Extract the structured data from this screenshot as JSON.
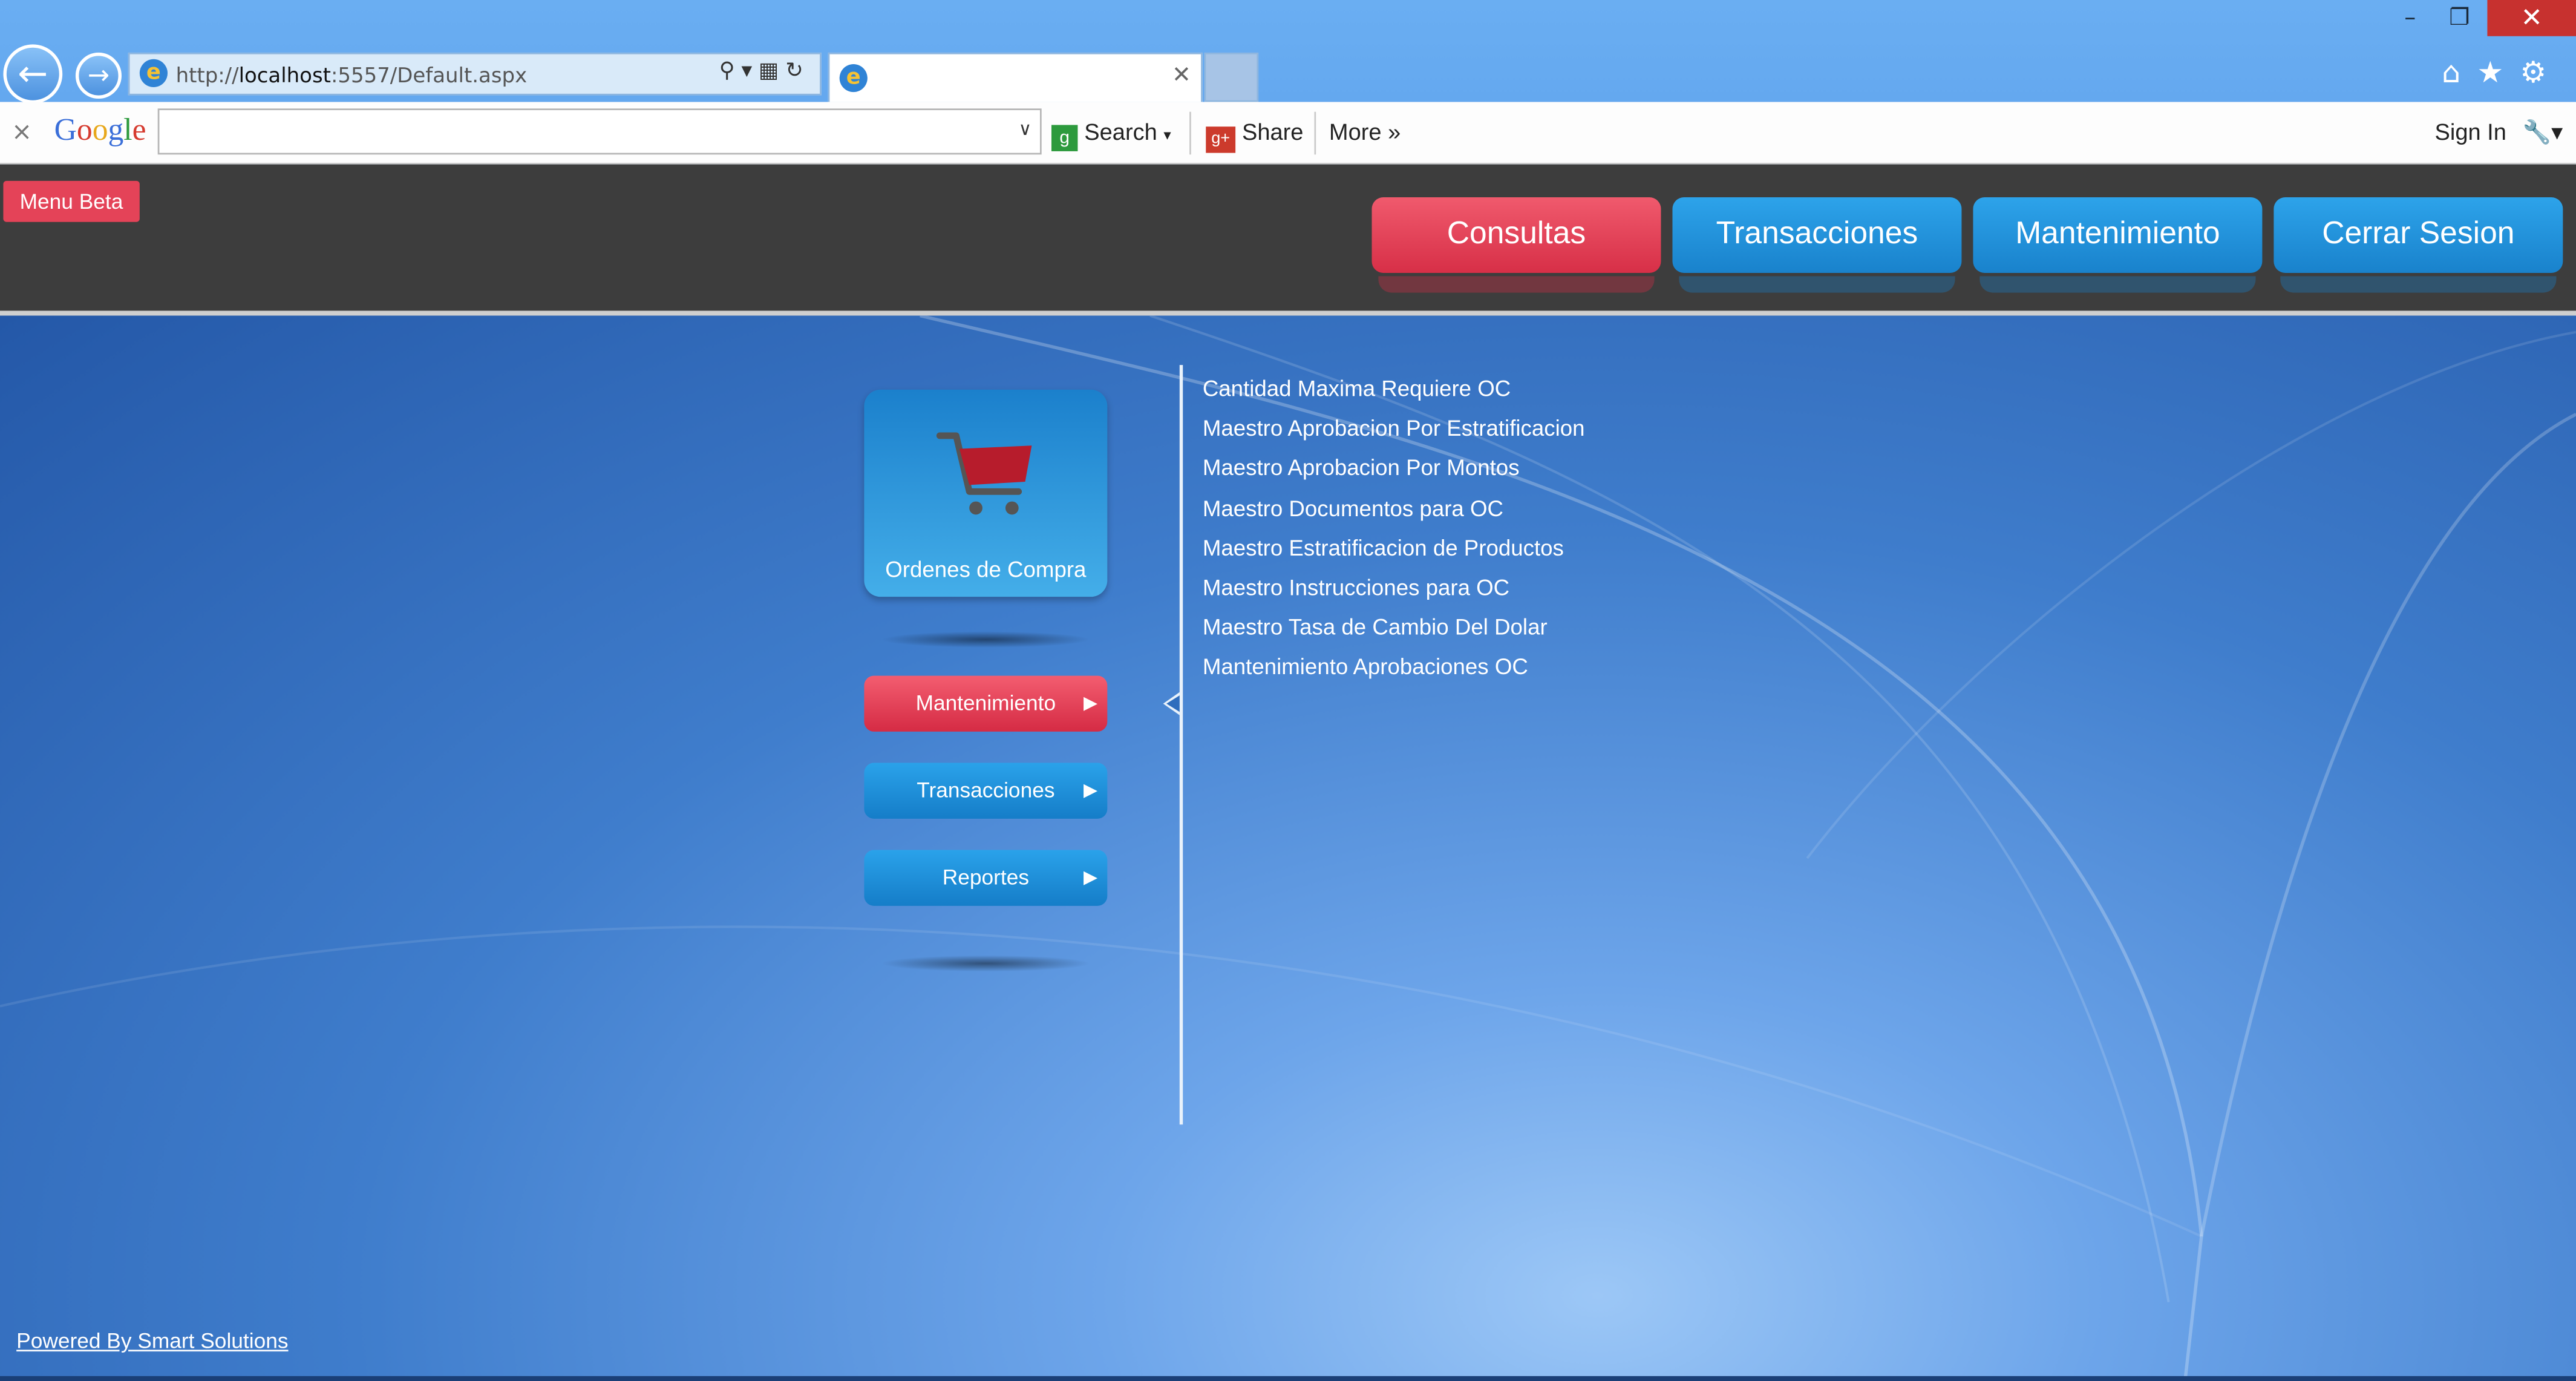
{
  "browser": {
    "url_prefix": "http://",
    "url_host": "localhost",
    "url_rest": ":5557/Default.aspx",
    "tab_title": "",
    "window_controls": [
      "minimize",
      "restore",
      "close"
    ]
  },
  "google_toolbar": {
    "close_label": "×",
    "logo": [
      "G",
      "o",
      "o",
      "g",
      "l",
      "e"
    ],
    "search_value": "",
    "search_label": "Search",
    "share_label": "Share",
    "more_label": "More »",
    "sign_in_label": "Sign In"
  },
  "header": {
    "menu_beta_label": "Menu Beta",
    "nav": [
      {
        "label": "Consultas",
        "active": true
      },
      {
        "label": "Transacciones",
        "active": false
      },
      {
        "label": "Mantenimiento",
        "active": false
      },
      {
        "label": "Cerrar Sesion",
        "active": false
      }
    ]
  },
  "module": {
    "tile_label": "Ordenes de Compra",
    "tile_icon": "shopping-cart-icon",
    "sections": [
      {
        "label": "Mantenimiento",
        "active": true
      },
      {
        "label": "Transacciones",
        "active": false
      },
      {
        "label": "Reportes",
        "active": false
      }
    ],
    "links": [
      "Cantidad Maxima Requiere OC",
      "Maestro Aprobacion Por Estratificacion",
      "Maestro Aprobacion Por Montos",
      "Maestro Documentos para OC",
      "Maestro Estratificacion de Productos",
      "Maestro Instrucciones para OC",
      "Maestro Tasa de Cambio Del Dolar",
      "Mantenimiento Aprobaciones OC"
    ]
  },
  "footer": {
    "powered_by": "Powered By Smart Solutions"
  },
  "colors": {
    "accent_red": "#e44358",
    "accent_blue": "#1e8fd9",
    "header_bg": "#3d3d3d",
    "main_bg": "#2f63b0"
  }
}
